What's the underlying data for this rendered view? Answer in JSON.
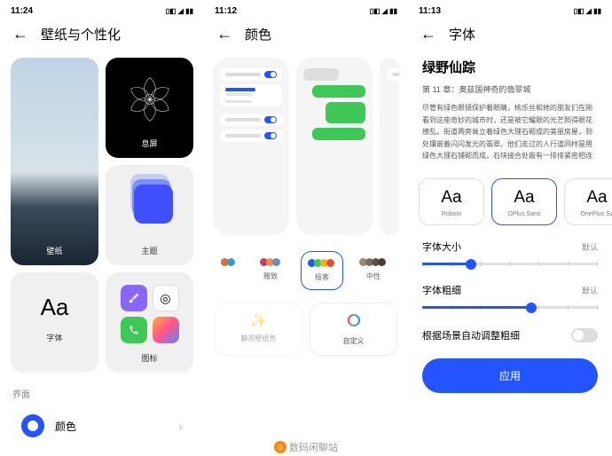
{
  "screen1": {
    "time": "11:24",
    "title": "壁纸与个性化",
    "tiles": {
      "wallpaper": "壁纸",
      "aod": "息屏",
      "theme": "主题",
      "font": "字体",
      "font_sample": "Aa",
      "icons": "图标"
    },
    "section_label": "界面",
    "color_row": "颜色"
  },
  "screen2": {
    "time": "11:12",
    "title": "颜色",
    "palettes": [
      {
        "label": "雅致",
        "colors": [
          "#c84060",
          "#e89050",
          "#6a8cc0"
        ]
      },
      {
        "label": "极客",
        "colors": [
          "#2255ff",
          "#3dc858",
          "#f0b020",
          "#e05030"
        ],
        "selected": true
      },
      {
        "label": "中性",
        "colors": [
          "#9a8a70",
          "#7a6a60",
          "#60504a",
          "#4a3c38"
        ]
      }
    ],
    "custom": {
      "pick": "静态壁纸色",
      "custom": "自定义"
    },
    "watermark": "数码闲聊站"
  },
  "screen3": {
    "time": "11:13",
    "title": "字体",
    "preview": {
      "heading": "绿野仙踪",
      "chapter": "第 11 章：奥兹国神奇的翡翠城",
      "body": "尽管有绿色眼镜保护着眼睛，桃乐丝和她的朋友们在刚看到这座奇妙的城市时，还是被它耀眼的光芒照得眼花缭乱。街道两旁耸立着绿色大理石砌成的美丽房屋，到处镶嵌着闪闪发光的翡翠。他们走过的人行道同样是用绿色大理石铺砌而成，石块接合处嵌有一排排紧密相连的翡翠，在阳光的照耀"
    },
    "fonts": [
      {
        "sample": "Aa",
        "name": "Roboto"
      },
      {
        "sample": "Aa",
        "name": "OPlus Sans",
        "selected": true
      },
      {
        "sample": "Aa",
        "name": "OnePlus Sa"
      }
    ],
    "size": {
      "label": "字体大小",
      "value": "默认",
      "pct": 28
    },
    "weight": {
      "label": "字体粗细",
      "value": "默认",
      "pct": 62
    },
    "auto_weight": "根据场景自动调整粗细",
    "apply": "应用"
  }
}
